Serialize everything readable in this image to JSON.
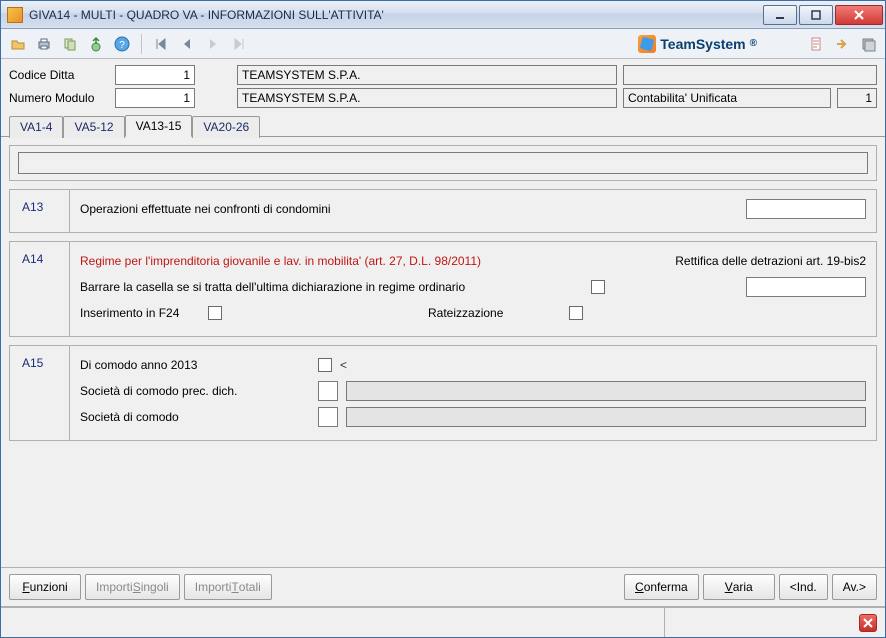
{
  "window": {
    "title": "GIVA14  - MULTI -  QUADRO VA - INFORMAZIONI SULL'ATTIVITA'"
  },
  "brand": {
    "name": "TeamSystem",
    "reg": "®"
  },
  "header": {
    "codice_ditta_label": "Codice Ditta",
    "codice_ditta_value": "1",
    "codice_ditta_name": "TEAMSYSTEM S.P.A.",
    "numero_modulo_label": "Numero Modulo",
    "numero_modulo_value": "1",
    "numero_modulo_name": "TEAMSYSTEM S.P.A.",
    "contabilita": "Contabilita' Unificata",
    "contabilita_n": "1"
  },
  "tabs": [
    {
      "label": "VA1-4",
      "active": false
    },
    {
      "label": "VA5-12",
      "active": false
    },
    {
      "label": "VA13-15",
      "active": true
    },
    {
      "label": "VA20-26",
      "active": false
    }
  ],
  "a13": {
    "code": "A13",
    "text": "Operazioni effettuate nei confronti di condomini"
  },
  "a14": {
    "code": "A14",
    "regime": "Regime per l'imprenditoria giovanile e lav. in mobilita' (art. 27, D.L. 98/2011)",
    "rettifica": "Rettifica delle detrazioni art. 19-bis2",
    "barrare": "Barrare la casella se si tratta dell'ultima dichiarazione in regime ordinario",
    "inserimento": "Inserimento in F24",
    "rateizzazione": "Rateizzazione"
  },
  "a15": {
    "code": "A15",
    "di_comodo_anno": "Di comodo anno 2013",
    "lt": "<",
    "prec": "Società di comodo prec. dich.",
    "soc": "Società di comodo"
  },
  "buttons": {
    "funzioni_pre": "F",
    "funzioni": "unzioni",
    "imp_sing_pre": "Importi ",
    "imp_sing_u": "S",
    "imp_sing_post": "ingoli",
    "imp_tot_pre": "Importi ",
    "imp_tot_u": "T",
    "imp_tot_post": "otali",
    "conferma_u": "C",
    "conferma": "onferma",
    "varia_pre": "",
    "varia_u": "V",
    "varia_post": "aria",
    "ind": "<Ind.",
    "av": "Av.>"
  }
}
